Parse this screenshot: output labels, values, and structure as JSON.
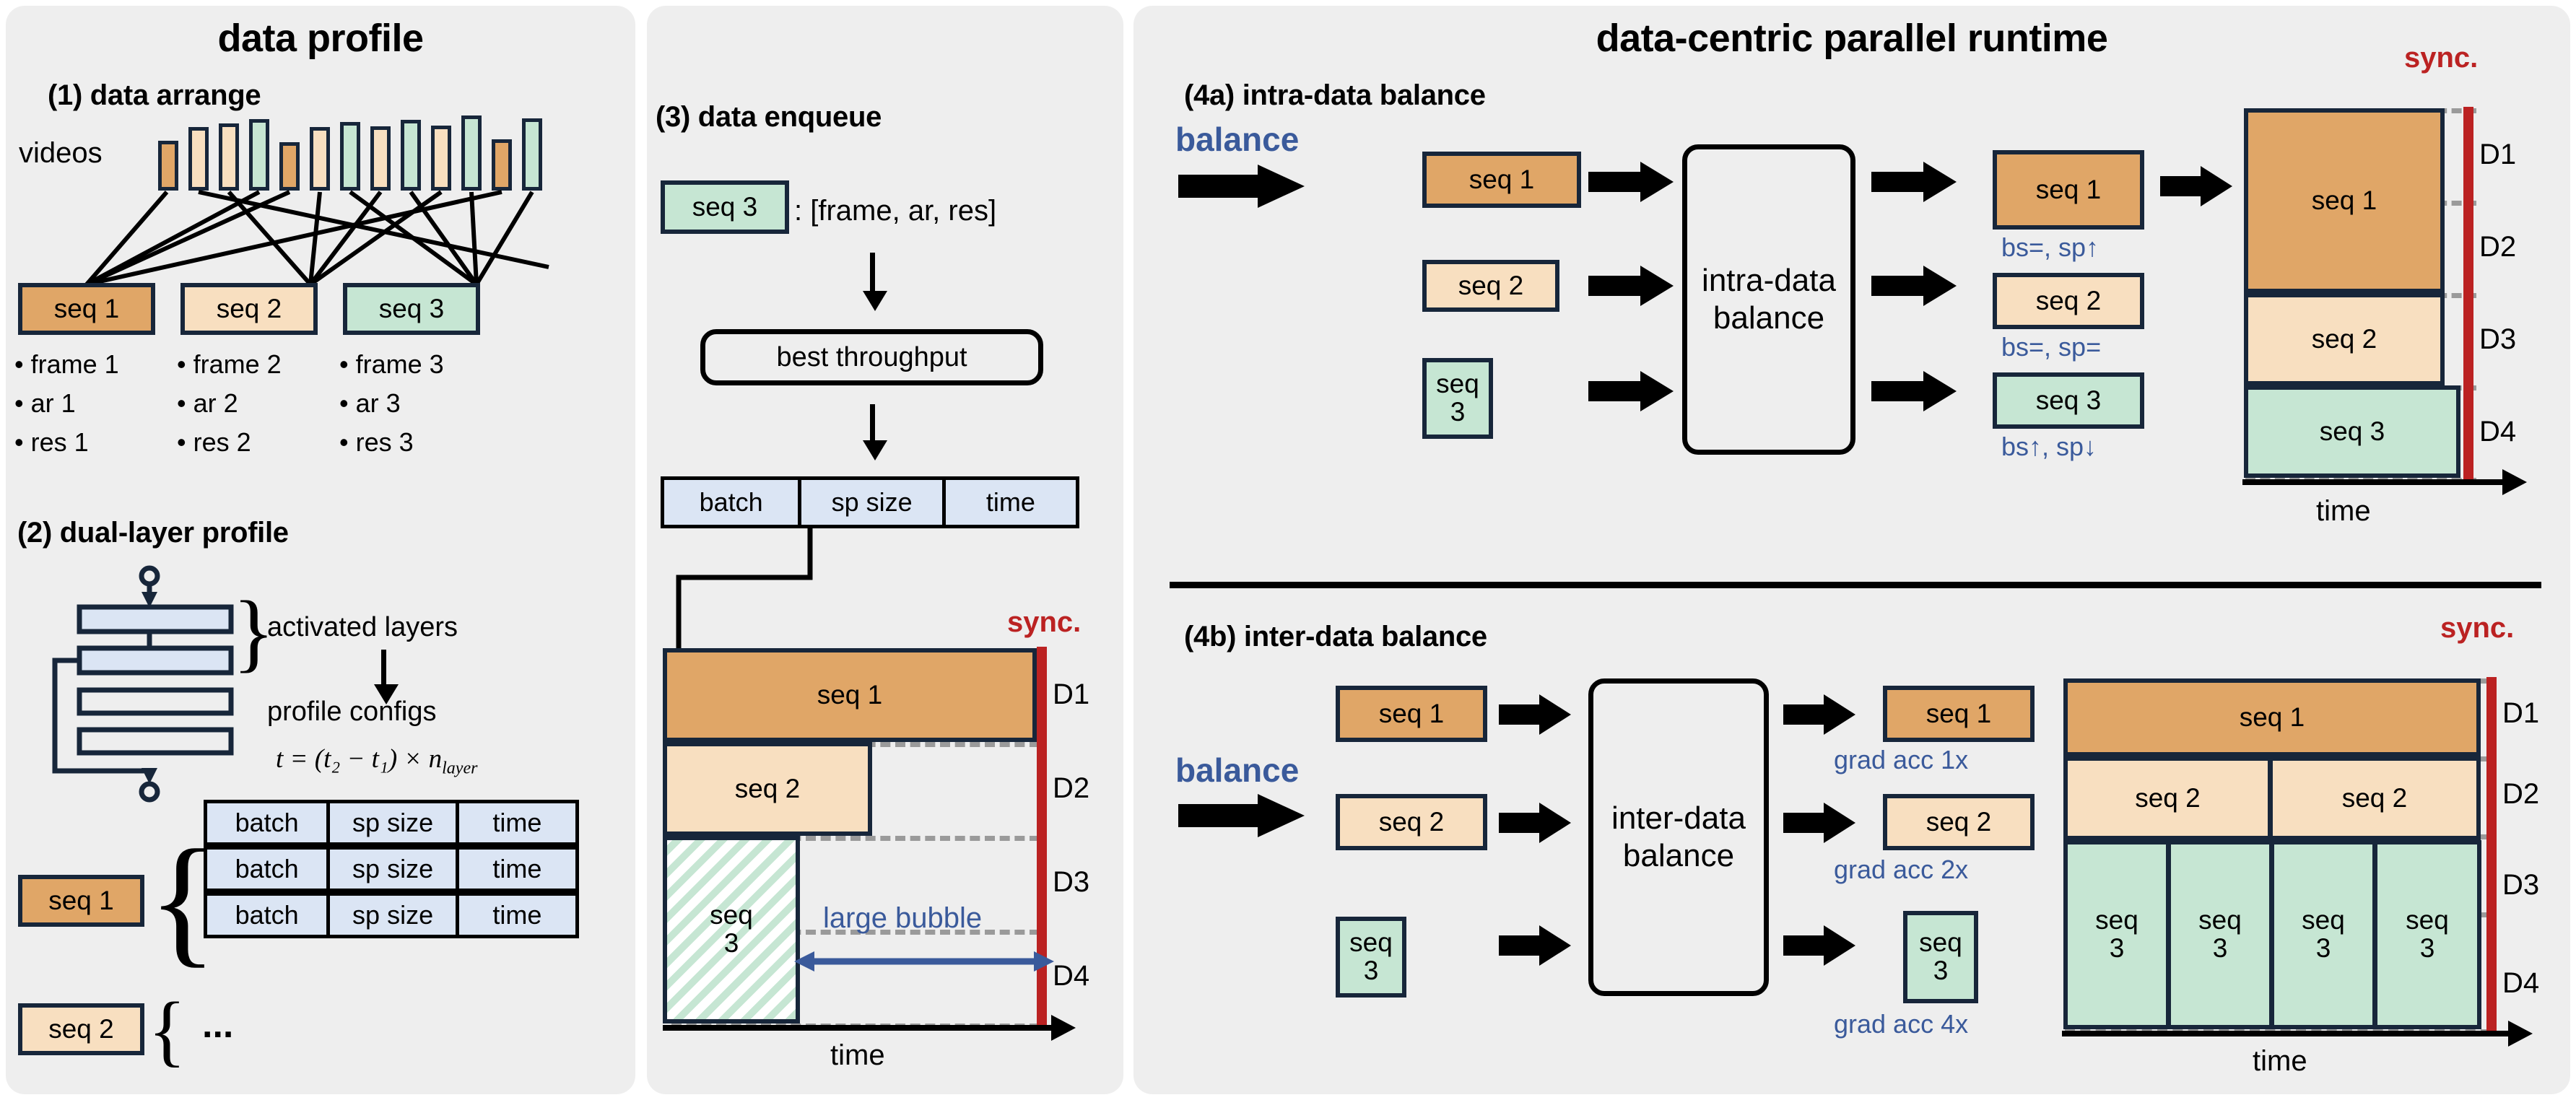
{
  "panels": {
    "left_title": "data profile",
    "mid_title": "",
    "right_title": "data-centric parallel runtime"
  },
  "section1": {
    "title": "(1) data arrange",
    "videos_label": "videos",
    "seq_boxes": [
      {
        "label": "seq 1",
        "color": "#e0a667"
      },
      {
        "label": "seq 2",
        "color": "#f8dfc0"
      },
      {
        "label": "seq 3",
        "color": "#c6e6d3"
      }
    ],
    "attr_lists": [
      [
        "• frame 1",
        "• ar 1",
        "• res 1"
      ],
      [
        "• frame 2",
        "• ar 2",
        "• res 2"
      ],
      [
        "• frame 3",
        "• ar 3",
        "• res 3"
      ]
    ]
  },
  "section2": {
    "title": "(2) dual-layer profile",
    "activated_layers_label": "activated layers",
    "profile_configs_label": "profile configs",
    "formula": "t = (t₂ − t₁) × n",
    "formula_sub": "layer",
    "table_headers": [
      "batch",
      "sp size",
      "time"
    ],
    "table_rows": [
      [
        "batch",
        "sp size",
        "time"
      ],
      [
        "batch",
        "sp size",
        "time"
      ],
      [
        "batch",
        "sp size",
        "time"
      ]
    ],
    "seq1_label": "seq 1",
    "seq2_label": "seq 2",
    "ellipsis": "..."
  },
  "section3": {
    "title": "(3) data enqueue",
    "seq_chip": "seq 3",
    "seq_meta": ": [frame, ar, res]",
    "best_throughput": "best throughput",
    "table_headers": [
      "batch",
      "sp size",
      "time"
    ],
    "timeline": {
      "bars": [
        {
          "label": "seq 1",
          "color": "#e0a667",
          "row": "D1"
        },
        {
          "label": "seq 2",
          "color": "#f8dfc0",
          "row": "D2"
        },
        {
          "label": "seq\n3",
          "color": "#c6e6d3",
          "row": "D3"
        }
      ],
      "row_labels": [
        "D1",
        "D2",
        "D3",
        "D4"
      ],
      "sync_label": "sync.",
      "bubble_label": "large bubble",
      "time_label": "time"
    }
  },
  "section4a": {
    "title": "(4a) intra-data balance",
    "balance_label": "balance",
    "process_box": "intra-data\nbalance",
    "inputs": [
      {
        "label": "seq 1",
        "color": "#e0a667"
      },
      {
        "label": "seq 2",
        "color": "#f8dfc0"
      },
      {
        "label": "seq\n3",
        "color": "#c6e6d3"
      }
    ],
    "outputs": [
      {
        "label": "seq 1",
        "color": "#e0a667",
        "note": "bs=, sp↑"
      },
      {
        "label": "seq 2",
        "color": "#f8dfc0",
        "note": "bs=, sp="
      },
      {
        "label": "seq 3",
        "color": "#c6e6d3",
        "note": "bs↑, sp↓"
      }
    ],
    "timeline": {
      "bars": [
        {
          "label": "seq 1",
          "color": "#e0a667"
        },
        {
          "label": "seq 2",
          "color": "#f8dfc0"
        },
        {
          "label": "seq 3",
          "color": "#c6e6d3"
        }
      ],
      "row_labels": [
        "D1",
        "D2",
        "D3",
        "D4"
      ],
      "sync_label": "sync.",
      "time_label": "time"
    }
  },
  "section4b": {
    "title": "(4b) inter-data balance",
    "balance_label": "balance",
    "process_box": "inter-data\nbalance",
    "inputs": [
      {
        "label": "seq 1",
        "color": "#e0a667"
      },
      {
        "label": "seq 2",
        "color": "#f8dfc0"
      },
      {
        "label": "seq\n3",
        "color": "#c6e6d3"
      }
    ],
    "outputs": [
      {
        "label": "seq 1",
        "color": "#e0a667",
        "note": "grad acc 1x"
      },
      {
        "label": "seq 2",
        "color": "#f8dfc0",
        "note": "grad acc 2x"
      },
      {
        "label": "seq\n3",
        "color": "#c6e6d3",
        "note": "grad acc 4x"
      }
    ],
    "timeline": {
      "row1": [
        "seq 1"
      ],
      "row2": [
        "seq 2",
        "seq 2"
      ],
      "row3": [
        "seq\n3",
        "seq\n3",
        "seq\n3",
        "seq\n3"
      ],
      "row_labels": [
        "D1",
        "D2",
        "D3",
        "D4"
      ],
      "sync_label": "sync.",
      "time_label": "time"
    }
  },
  "colors": {
    "orange": "#e0a667",
    "peach": "#f8dfc0",
    "green": "#c6e6d3",
    "blue": "#dbe5f4",
    "outline": "#17263a",
    "sync_red": "#bb2222",
    "accent_blue": "#3a5a9b",
    "panel_bg": "#eeeeee"
  }
}
